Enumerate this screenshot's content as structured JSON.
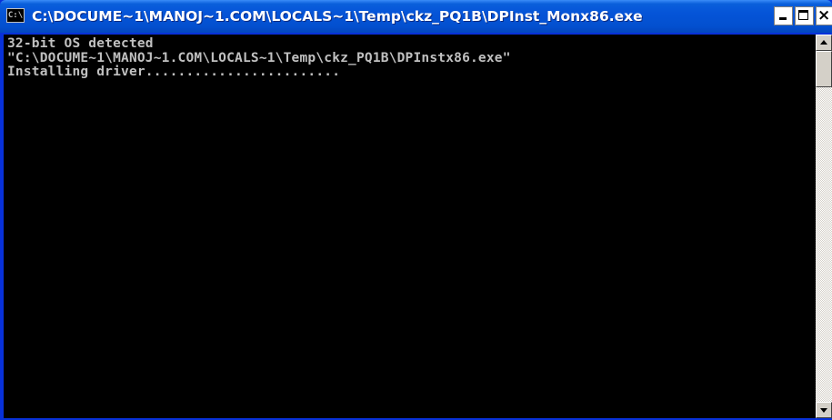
{
  "window": {
    "title": "C:\\DOCUME~1\\MANOJ~1.COM\\LOCALS~1\\Temp\\ckz_PQ1B\\DPInst_Monx86.exe",
    "icon_label": "C:\\",
    "icon": "console-icon",
    "controls": {
      "minimize_icon": "minimize-icon",
      "maximize_icon": "maximize-icon",
      "close_icon": "close-icon",
      "close_glyph": "×"
    }
  },
  "console": {
    "lines": [
      "32-bit OS detected",
      "\"C:\\DOCUME~1\\MANOJ~1.COM\\LOCALS~1\\Temp\\ckz_PQ1B\\DPInstx86.exe\"",
      "Installing driver........................"
    ],
    "text_color": "#c0c0c0",
    "background": "#000000"
  },
  "theme": {
    "titlebar_color": "#0554d8",
    "title_text_color": "#ffffff"
  }
}
